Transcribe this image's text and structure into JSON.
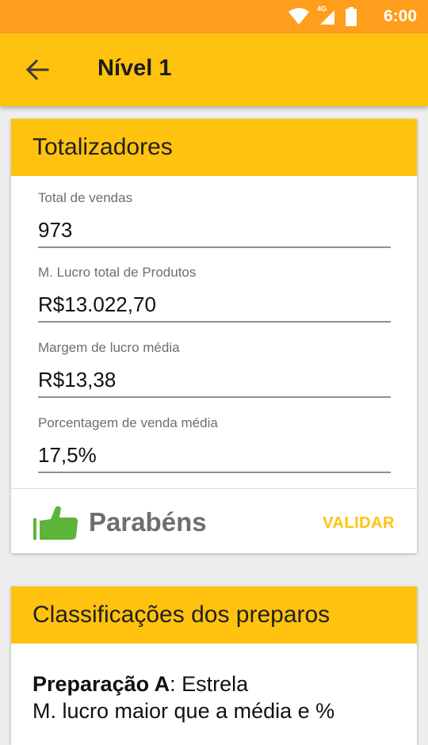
{
  "status_bar": {
    "time": "6:00",
    "network_label": "4G",
    "icons": [
      "wifi-icon",
      "signal-icon",
      "battery-icon"
    ]
  },
  "app_bar": {
    "title": "Nível 1",
    "back_icon": "arrow-back-icon"
  },
  "totalizadores": {
    "title": "Totalizadores",
    "fields": [
      {
        "label": "Total de vendas",
        "value": "973"
      },
      {
        "label": "M. Lucro total de Produtos",
        "value": "R$13.022,70"
      },
      {
        "label": "Margem de lucro média",
        "value": "R$13,38"
      },
      {
        "label": "Porcentagem de venda média",
        "value": "17,5%"
      }
    ],
    "result_icon": "thumbs-up-icon",
    "result_text": "Parabéns",
    "validate_label": "VALIDAR"
  },
  "classificacoes": {
    "title": "Classificações dos preparos",
    "item_name": "Preparação A",
    "item_separator": ": ",
    "item_class": "Estrela",
    "item_desc": "M. lucro maior que a média e %"
  },
  "colors": {
    "status_bar": "#ff9d1c",
    "accent": "#ffc20e",
    "thumb": "#5cb53a",
    "background": "#eeeeee"
  }
}
